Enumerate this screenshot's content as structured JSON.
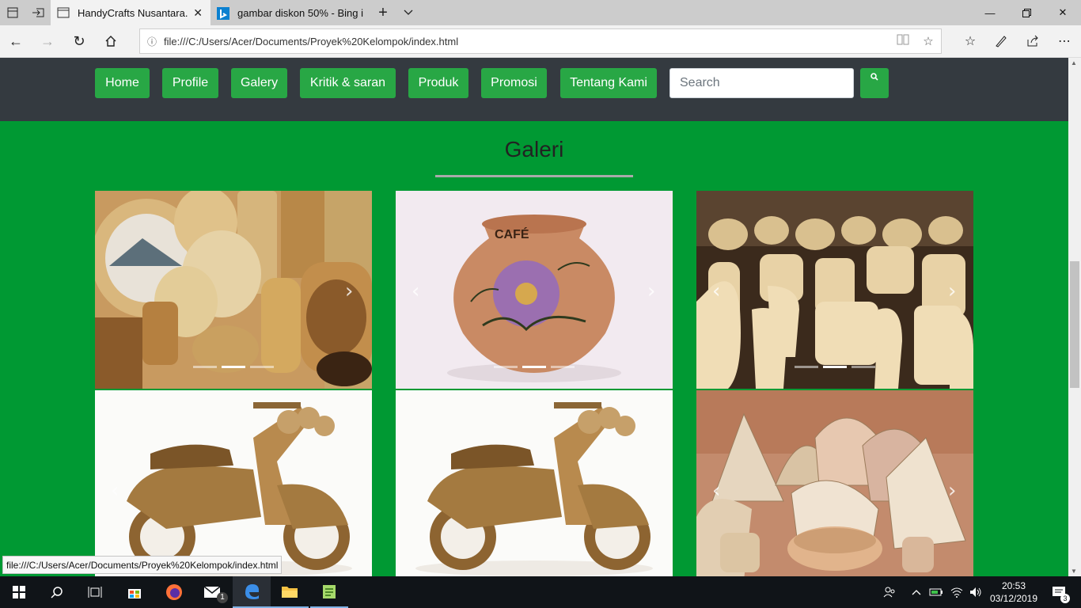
{
  "browser": {
    "tabs": [
      {
        "title": "HandyCrafts Nusantara.",
        "active": true
      },
      {
        "title": "gambar diskon 50% - Bing i",
        "active": false
      }
    ],
    "url": "file:///C:/Users/Acer/Documents/Proyek%20Kelompok/index.html",
    "status_url": "file:///C:/Users/Acer/Documents/Proyek%20Kelompok/index.html"
  },
  "nav": {
    "items": [
      "Home",
      "Profile",
      "Galery",
      "Kritik & saran",
      "Produk",
      "Promosi",
      "Tentang Kami"
    ],
    "search_placeholder": "Search",
    "search_button": "🔍"
  },
  "gallery": {
    "title": "Galeri",
    "items": [
      {
        "subject": "birch bark crafts"
      },
      {
        "subject": "cafe clay pot",
        "caption_on_image": "CAFÉ"
      },
      {
        "subject": "clay vases"
      },
      {
        "subject": "wooden scooter model"
      },
      {
        "subject": "wooden scooter model"
      },
      {
        "subject": "bamboo woven baskets"
      }
    ]
  },
  "taskbar": {
    "clock_time": "20:53",
    "clock_date": "03/12/2019",
    "mail_badge": "1",
    "notification_badge": "3"
  },
  "colors": {
    "page_bg": "#009933",
    "navbar_bg": "#343a40",
    "button_green": "#28a745"
  }
}
